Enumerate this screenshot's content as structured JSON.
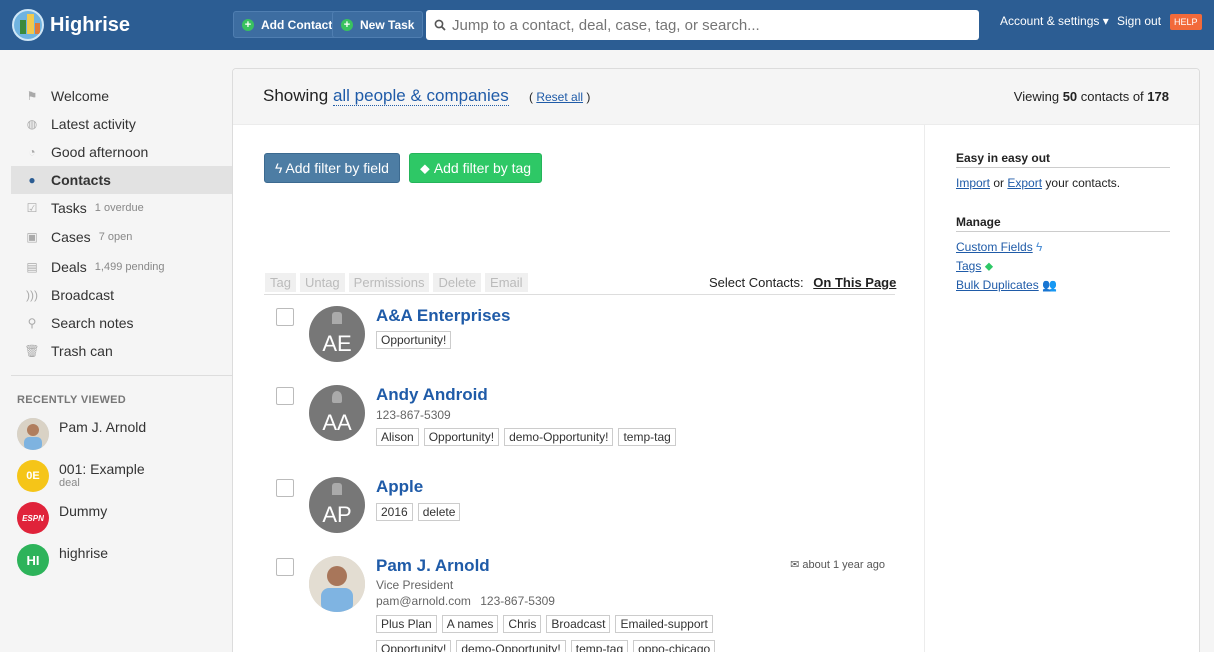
{
  "header": {
    "brand": "Highrise",
    "add_contact": "Add Contact",
    "new_task": "New Task",
    "search_placeholder": "Jump to a contact, deal, case, tag, or search...",
    "account": "Account & settings ▾",
    "sign_out": "Sign out",
    "help": "HELP"
  },
  "sidebar": {
    "items": [
      {
        "label": "Welcome",
        "sub": "",
        "icon": "flag-icon"
      },
      {
        "label": "Latest activity",
        "sub": "",
        "icon": "activity-icon"
      },
      {
        "label": "Good afternoon",
        "sub": "",
        "icon": "sun-icon"
      },
      {
        "label": "Contacts",
        "sub": "",
        "icon": "person-icon"
      },
      {
        "label": "Tasks",
        "sub": "1 overdue",
        "icon": "checkbox-icon"
      },
      {
        "label": "Cases",
        "sub": "7 open",
        "icon": "briefcase-icon"
      },
      {
        "label": "Deals",
        "sub": "1,499 pending",
        "icon": "money-icon"
      },
      {
        "label": "Broadcast",
        "sub": "",
        "icon": "broadcast-icon"
      },
      {
        "label": "Search notes",
        "sub": "",
        "icon": "search-icon"
      },
      {
        "label": "Trash can",
        "sub": "",
        "icon": "trash-icon"
      }
    ],
    "recent_title": "RECENTLY VIEWED",
    "recent": [
      {
        "name": "Pam J. Arnold",
        "sub": "",
        "initials": ""
      },
      {
        "name": "001: Example",
        "sub": "deal",
        "initials": "0E"
      },
      {
        "name": "Dummy",
        "sub": "",
        "initials": "ESPN"
      },
      {
        "name": "highrise",
        "sub": "",
        "initials": "HI"
      }
    ]
  },
  "main": {
    "showing_prefix": "Showing",
    "showing_link": "all people & companies",
    "reset_open": "(",
    "reset_label": "Reset all",
    "reset_close": ")",
    "viewing_prefix": "Viewing",
    "viewing_count": "50",
    "viewing_mid": "contacts of",
    "viewing_total": "178",
    "filter_field": "Add filter by field",
    "filter_tag": "Add filter by tag",
    "bulk_actions": [
      "Tag",
      "Untag",
      "Permissions",
      "Delete",
      "Email"
    ],
    "select_label": "Select Contacts:",
    "select_link": "On This Page"
  },
  "contacts": [
    {
      "name": "A&A Enterprises",
      "initials": "AE",
      "title": "",
      "email": "",
      "phone": "",
      "tags": [
        "Opportunity!"
      ],
      "stamp": ""
    },
    {
      "name": "Andy Android",
      "initials": "AA",
      "title": "",
      "email": "",
      "phone": "123-867-5309",
      "tags": [
        "Alison",
        "Opportunity!",
        "demo-Opportunity!",
        "temp-tag"
      ],
      "stamp": ""
    },
    {
      "name": "Apple",
      "initials": "AP",
      "title": "",
      "email": "",
      "phone": "",
      "tags": [
        "2016",
        "delete"
      ],
      "stamp": ""
    },
    {
      "name": "Pam J. Arnold",
      "initials": "",
      "title": "Vice President",
      "email": "pam@arnold.com",
      "phone": "123-867-5309",
      "tags": [
        "Plus Plan",
        "A names",
        "Chris",
        "Broadcast",
        "Emailed-support"
      ],
      "tags2": [
        "Opportunity!",
        "demo-Opportunity!",
        "temp-tag",
        "oppo-chicago"
      ],
      "stamp": "about 1 year ago"
    }
  ],
  "right": {
    "easy_title": "Easy in easy out",
    "import": "Import",
    "or": "or",
    "export": "Export",
    "your_contacts": "your contacts.",
    "manage_title": "Manage",
    "custom_fields": "Custom Fields",
    "tags": "Tags",
    "bulk_duplicates": "Bulk Duplicates"
  }
}
